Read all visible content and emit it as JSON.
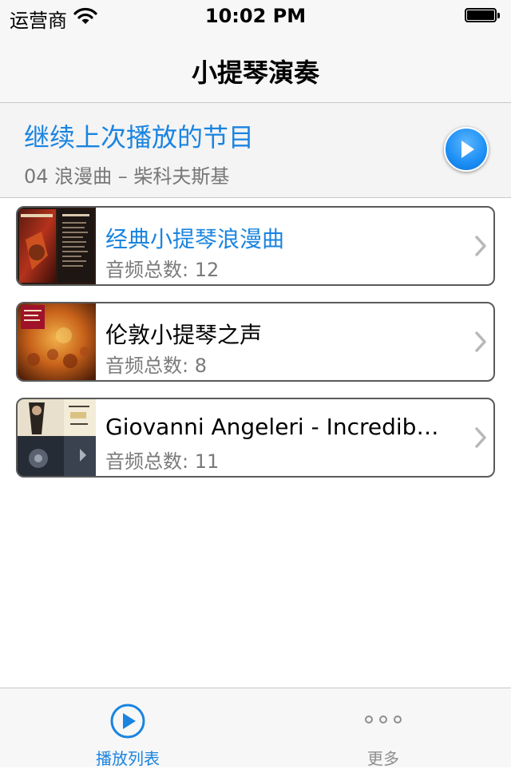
{
  "status_bar": {
    "carrier": "运营商",
    "time": "10:02 PM"
  },
  "nav": {
    "title": "小提琴演奏"
  },
  "resume": {
    "title": "继续上次播放的节目",
    "subtitle": "04 浪漫曲  – 柴科夫斯基"
  },
  "playlists": [
    {
      "title": "经典小提琴浪漫曲",
      "count": "音频总数: 12",
      "active": true
    },
    {
      "title": "伦敦小提琴之声",
      "count": "音频总数: 8",
      "active": false
    },
    {
      "title": "Giovanni Angeleri - Incredible Violin",
      "count": "音频总数: 11",
      "active": false
    }
  ],
  "tabs": [
    {
      "label": "播放列表",
      "icon": "play-circle-icon",
      "selected": true
    },
    {
      "label": "更多",
      "icon": "more-dots-icon",
      "selected": false
    }
  ],
  "colors": {
    "accent": "#1a84e0",
    "secondary_text": "#777777",
    "bar_background": "#f7f7f7"
  }
}
